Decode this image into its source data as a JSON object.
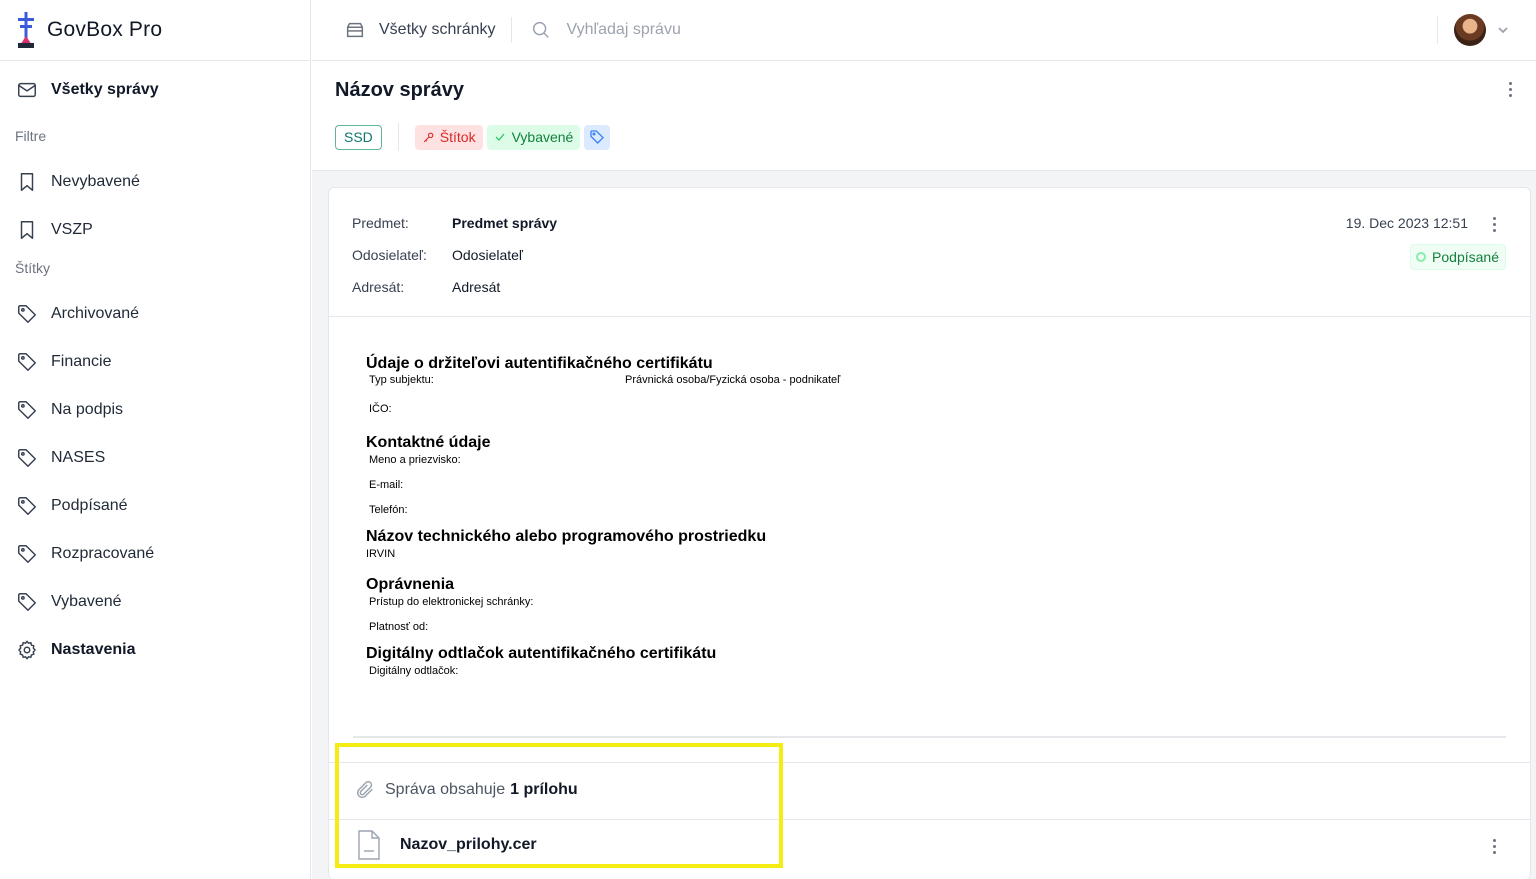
{
  "app": {
    "name": "GovBox Pro"
  },
  "sidebar": {
    "all_messages": "Všetky správy",
    "filters_heading": "Filtre",
    "filters": [
      {
        "label": "Nevybavené",
        "icon": "bookmark-icon"
      },
      {
        "label": "VSZP",
        "icon": "bookmark-icon"
      }
    ],
    "tags_heading": "Štítky",
    "tags": [
      {
        "label": "Archivované",
        "icon": "tag-icon"
      },
      {
        "label": "Financie",
        "icon": "tag-icon"
      },
      {
        "label": "Na podpis",
        "icon": "tag-icon"
      },
      {
        "label": "NASES",
        "icon": "tag-icon"
      },
      {
        "label": "Podpísané",
        "icon": "tag-icon"
      },
      {
        "label": "Rozpracované",
        "icon": "tag-icon"
      },
      {
        "label": "Vybavené",
        "icon": "tag-icon"
      }
    ],
    "settings": "Nastavenia"
  },
  "topbar": {
    "inbox_label": "Všetky schránky",
    "search_placeholder": "Vyhľadaj správu"
  },
  "message": {
    "title": "Názov správy",
    "tags": {
      "ssd": "SSD",
      "stitok": "Štítok",
      "vybavene": "Vybavené"
    },
    "subject_label": "Predmet:",
    "subject_value": "Predmet správy",
    "sender_label": "Odosielateľ:",
    "sender_value": "Odosielateľ",
    "recipient_label": "Adresát:",
    "recipient_value": "Adresát",
    "date": "19. Dec 2023 12:51",
    "signed_badge": "Podpísané"
  },
  "form": {
    "s1_title": "Údaje o držiteľovi autentifikačného certifikátu",
    "s1_type_label": "Typ subjektu:",
    "s1_type_value": "Právnická osoba/Fyzická osoba - podnikateľ",
    "s1_ico_label": "IČO:",
    "s2_title": "Kontaktné údaje",
    "s2_name_label": "Meno a priezvisko:",
    "s2_email_label": "E-mail:",
    "s2_phone_label": "Telefón:",
    "s3_title": "Názov technického alebo programového prostriedku",
    "s3_value": "IRVIN",
    "s4_title": "Oprávnenia",
    "s4_access_label": "Prístup do elektronickej schránky:",
    "s4_valid_label": "Platnosť od:",
    "s5_title": "Digitálny odtlačok autentifikačného certifikátu",
    "s5_label": "Digitálny odtlačok:"
  },
  "attachments": {
    "prefix": "Správa obsahuje",
    "count_label": "1 prílohu",
    "file_name": "Nazov_prilohy.cer"
  },
  "colors": {
    "highlight": "#f5ec14",
    "tag_red": "#dc2626",
    "tag_green": "#15803d",
    "tag_blue": "#3b82f6"
  }
}
